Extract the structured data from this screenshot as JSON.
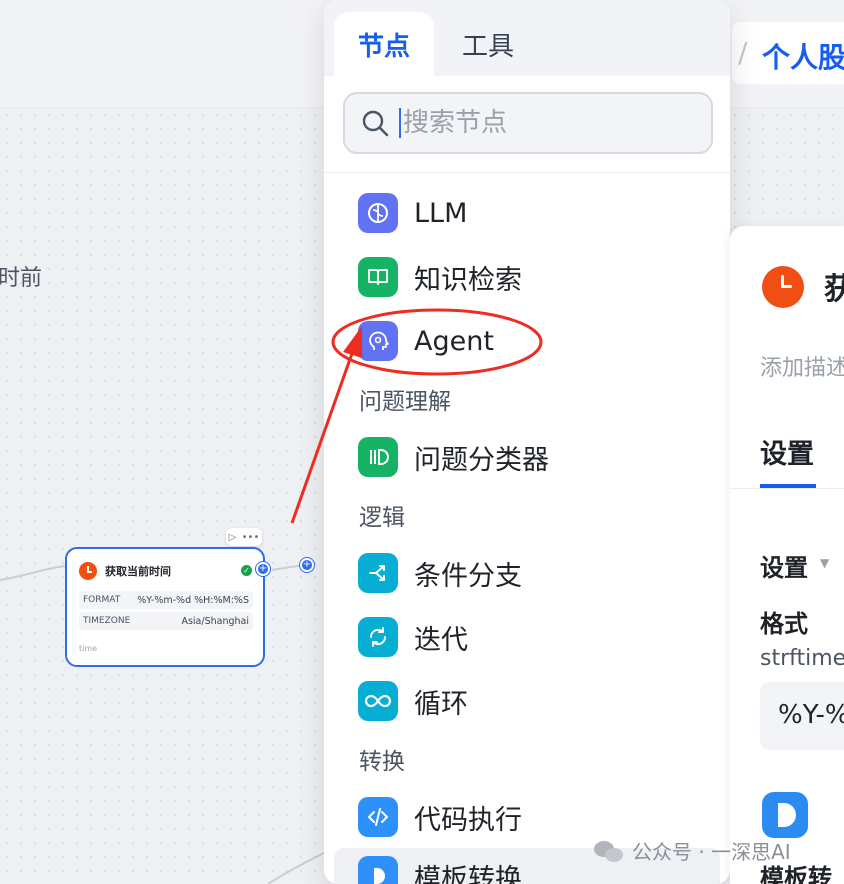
{
  "canvas": {
    "partial_label": "时前"
  },
  "breadcrumb": {
    "separator": "/",
    "title": "个人股"
  },
  "workflow_node": {
    "title": "获取当前时间",
    "status_check": "✓",
    "params": [
      {
        "key": "FORMAT",
        "value": "%Y-%m-%d %H:%M:%S"
      },
      {
        "key": "TIMEZONE",
        "value": "Asia/Shanghai"
      }
    ],
    "output_var": "time",
    "port_label": "+",
    "toolbar": {
      "run": "▷",
      "more": "•••"
    }
  },
  "panel": {
    "tabs": [
      {
        "label": "节点",
        "active": true
      },
      {
        "label": "工具",
        "active": false
      }
    ],
    "search": {
      "placeholder": "搜索节点",
      "value": ""
    },
    "items": [
      {
        "label": "LLM",
        "icon": "brain-icon",
        "color": "#6172f3"
      },
      {
        "label": "知识检索",
        "icon": "book-open-icon",
        "color": "#16b364"
      },
      {
        "label": "Agent",
        "icon": "agent-head-icon",
        "color": "#6172f3"
      },
      {
        "label": "问题分类器",
        "icon": "classifier-icon",
        "color": "#16b364"
      },
      {
        "label": "条件分支",
        "icon": "branch-icon",
        "color": "#06aed4"
      },
      {
        "label": "迭代",
        "icon": "iterate-icon",
        "color": "#06aed4"
      },
      {
        "label": "循环",
        "icon": "loop-infinity-icon",
        "color": "#06aed4"
      },
      {
        "label": "代码执行",
        "icon": "code-icon",
        "color": "#2e90fa"
      },
      {
        "label": "模板转换",
        "icon": "template-icon",
        "color": "#2e90fa"
      }
    ],
    "sections": [
      "问题理解",
      "逻辑",
      "转换"
    ]
  },
  "properties": {
    "title": "获",
    "description_placeholder": "添加描述",
    "tab": "设置",
    "section": "设置",
    "format_label": "格式",
    "format_help": "strftime",
    "format_value": "%Y-%",
    "next_node_label": "模板转"
  },
  "annotation": {
    "color": "#ee2c22",
    "target": "Agent"
  },
  "watermark": {
    "text": "公众号 · 一深思AI"
  }
}
